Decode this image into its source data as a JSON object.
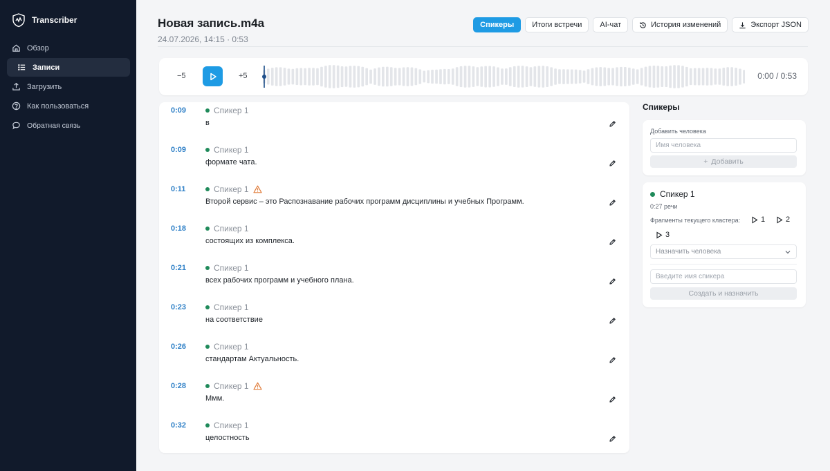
{
  "sidebar": {
    "brand": "Transcriber",
    "items": [
      {
        "label": "Обзор",
        "icon": "home-icon"
      },
      {
        "label": "Записи",
        "icon": "list-icon",
        "active": true
      },
      {
        "label": "Загрузить",
        "icon": "upload-icon"
      },
      {
        "label": "Как пользоваться",
        "icon": "help-icon"
      },
      {
        "label": "Обратная связь",
        "icon": "chat-icon"
      }
    ]
  },
  "header": {
    "title": "Новая запись.m4a",
    "meta": "24.07.2026, 14:15 · 0:53",
    "tabs": [
      {
        "label": "Спикеры",
        "active": true
      },
      {
        "label": "Итоги встречи"
      },
      {
        "label": "AI-чат"
      },
      {
        "label": "История изменений",
        "icon": "history-icon"
      },
      {
        "label": "Экспорт JSON",
        "icon": "download-icon"
      }
    ]
  },
  "player": {
    "skip_back": "−5",
    "skip_forward": "+5",
    "time": "0:00 / 0:53",
    "progress": 0
  },
  "segments": [
    {
      "time": "0:09",
      "speaker": "Спикер 1",
      "warning": false,
      "text": "в"
    },
    {
      "time": "0:09",
      "speaker": "Спикер 1",
      "warning": false,
      "text": "формате чата."
    },
    {
      "time": "0:11",
      "speaker": "Спикер 1",
      "warning": true,
      "text": "Второй сервис – это Распознавание рабочих программ дисциплины и учебных Программ."
    },
    {
      "time": "0:18",
      "speaker": "Спикер 1",
      "warning": false,
      "text": "состоящих из комплекса."
    },
    {
      "time": "0:21",
      "speaker": "Спикер 1",
      "warning": false,
      "text": "всех рабочих программ и учебного плана."
    },
    {
      "time": "0:23",
      "speaker": "Спикер 1",
      "warning": false,
      "text": "на соответствие"
    },
    {
      "time": "0:26",
      "speaker": "Спикер 1",
      "warning": false,
      "text": "стандартам Актуальность."
    },
    {
      "time": "0:28",
      "speaker": "Спикер 1",
      "warning": true,
      "text": "Ммм."
    },
    {
      "time": "0:32",
      "speaker": "Спикер 1",
      "warning": false,
      "text": "целостность"
    }
  ],
  "speakers_panel": {
    "title": "Спикеры",
    "add_label": "Добавить человека",
    "name_placeholder": "Имя человека",
    "add_button": "Добавить",
    "speaker": {
      "name": "Спикер 1",
      "duration": "0:27 речи",
      "fragments_label": "Фрагменты текущего кластера:",
      "fragments": [
        "1",
        "2",
        "3"
      ],
      "assign_placeholder": "Назначить человека",
      "speaker_name_placeholder": "Введите имя спикера",
      "create_button": "Создать и назначить"
    }
  },
  "colors": {
    "accent": "#1e9be4",
    "sidebar_bg": "#111a2b",
    "speaker_dot": "#1f8a5a",
    "warning": "#e07b39",
    "timestamp": "#2f80c7"
  }
}
